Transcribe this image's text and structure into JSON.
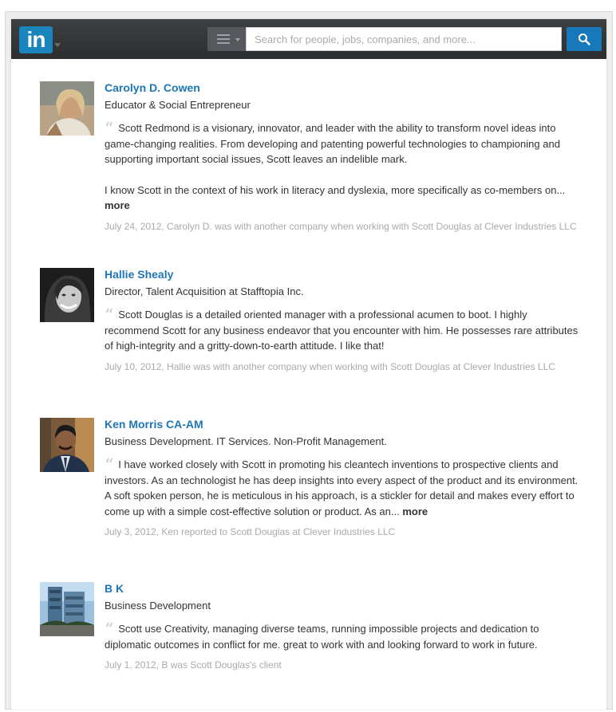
{
  "header": {
    "logo_text": "in",
    "search_placeholder": "Search for people, jobs, companies, and more...",
    "brand_color": "#1a84bc"
  },
  "recommendations": [
    {
      "name": "Carolyn D. Cowen",
      "headline": "Educator & Social Entrepreneur",
      "text_1": "Scott Redmond is a visionary, innovator, and leader with the ability to transform novel ideas into game-changing realities. From developing and patenting powerful technologies to championing and supporting important social issues, Scott leaves an indelible mark.",
      "text_2": "I know Scott in the context of his work in literacy and dyslexia, more specifically as co-members on...",
      "more_label": "more",
      "meta": "July 24, 2012, Carolyn D. was with another company when working with Scott Douglas at Clever Industries LLC"
    },
    {
      "name": "Hallie Shealy",
      "headline": "Director, Talent Acquisition at Stafftopia Inc.",
      "text_1": "Scott Douglas is a detailed oriented manager with a professional acumen to boot. I highly recommend Scott for any business endeavor that you encounter with him. He possesses rare attributes of high-integrity and a gritty-down-to-earth attitude. I like that!",
      "meta": "July 10, 2012, Hallie was with another company when working with Scott Douglas at Clever Industries LLC"
    },
    {
      "name": "Ken Morris CA-AM",
      "headline": "Business Development. IT Services. Non-Profit Management.",
      "text_1": "I have worked closely with Scott in promoting his cleantech inventions to prospective clients and investors. As an technologist he has deep insights into every aspect of the product and its environment. A soft spoken person, he is meticulous in his approach, is a stickler for detail and makes every effort to come up with a simple cost-effective solution or product. As an...",
      "more_label": "more",
      "meta": "July 3, 2012, Ken reported to Scott Douglas at Clever Industries LLC"
    },
    {
      "name": "B K",
      "headline": "Business Development",
      "text_1": "Scott use Creativity, managing diverse teams, running impossible projects and dedication to diplomatic outcomes in conflict for me. great to work with and looking forward to work in future.",
      "meta": "July 1, 2012, B was Scott Douglas's client"
    }
  ]
}
